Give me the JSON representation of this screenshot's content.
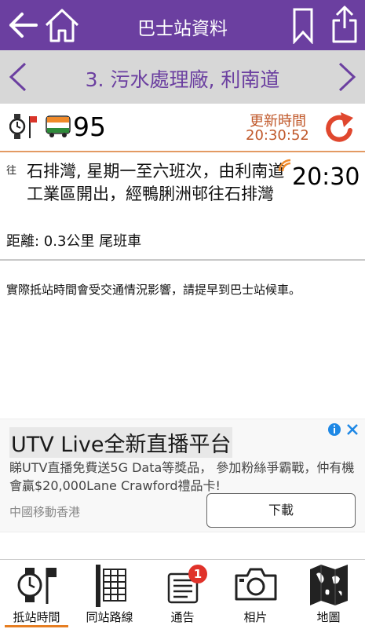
{
  "header": {
    "title": "巴士站資料",
    "color_brand": "#6b3fa0",
    "icons": [
      "back-arrow-icon",
      "home-icon",
      "bookmark-icon",
      "share-icon"
    ]
  },
  "stop": {
    "name": "3. 污水處理廠, 利南道",
    "prev_icon": "chevron-left-icon",
    "next_icon": "chevron-right-icon"
  },
  "route": {
    "number": "95",
    "update_label": "更新時間",
    "update_time": "20:30:52"
  },
  "eta": {
    "direction_label": "往",
    "description": "石排灣, 星期一至六班次，由利南道工業區開出，經鴨脷洲邨往石排灣",
    "time": "20:30",
    "distance": "距離: 0.3公里 尾班車"
  },
  "notice": "實際抵站時間會受交通情況影響，請提早到巴士站候車。",
  "ad": {
    "title": "UTV Live全新直播平台",
    "description": "睇UTV直播免費送5G Data等獎品， 參加粉絲爭霸戰，仲有機會贏$20,000Lane Crawford禮品卡!",
    "sponsor": "中國移動香港",
    "button": "下載"
  },
  "tabs": [
    {
      "label": "抵站時間",
      "icon": "watch-flag-icon",
      "active": true
    },
    {
      "label": "同站路線",
      "icon": "timetable-icon"
    },
    {
      "label": "通告",
      "icon": "notice-icon",
      "badge": "1"
    },
    {
      "label": "相片",
      "icon": "camera-icon"
    },
    {
      "label": "地圖",
      "icon": "map-icon"
    }
  ]
}
